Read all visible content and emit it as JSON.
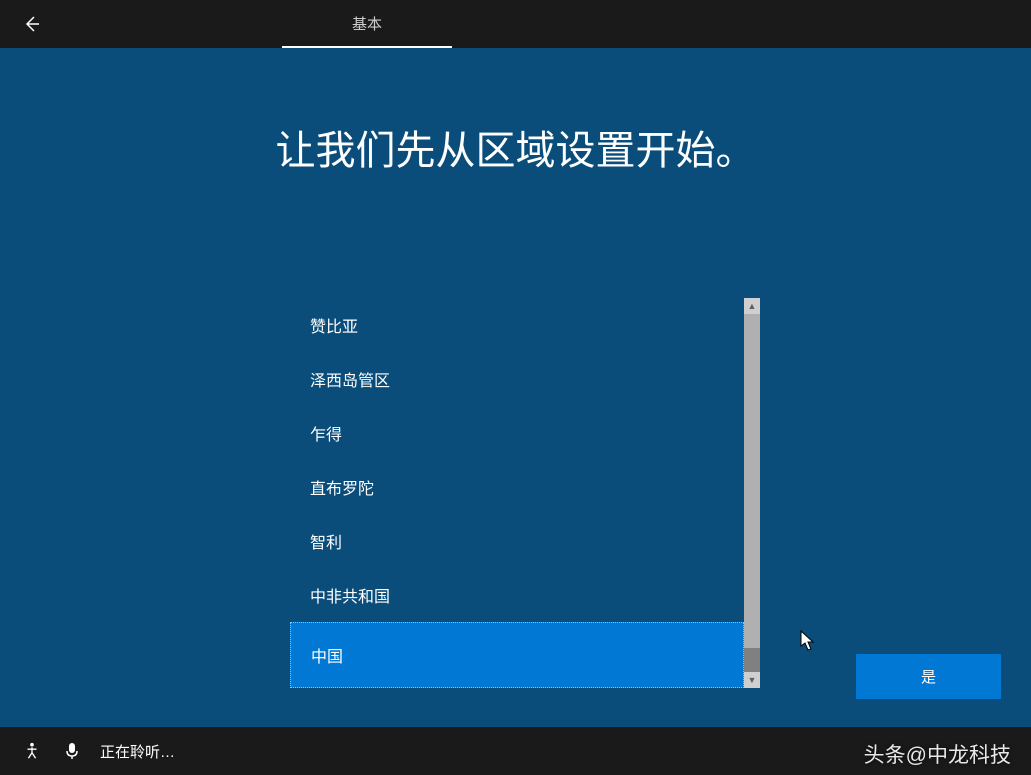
{
  "topBar": {
    "tab": "基本"
  },
  "main": {
    "title": "让我们先从区域设置开始。",
    "regions": [
      {
        "label": "赞比亚",
        "selected": false
      },
      {
        "label": "泽西岛管区",
        "selected": false
      },
      {
        "label": "乍得",
        "selected": false
      },
      {
        "label": "直布罗陀",
        "selected": false
      },
      {
        "label": "智利",
        "selected": false
      },
      {
        "label": "中非共和国",
        "selected": false
      },
      {
        "label": "中国",
        "selected": true
      }
    ],
    "confirmButton": "是"
  },
  "bottomBar": {
    "listeningText": "正在聆听…"
  },
  "watermark": "头条@中龙科技"
}
